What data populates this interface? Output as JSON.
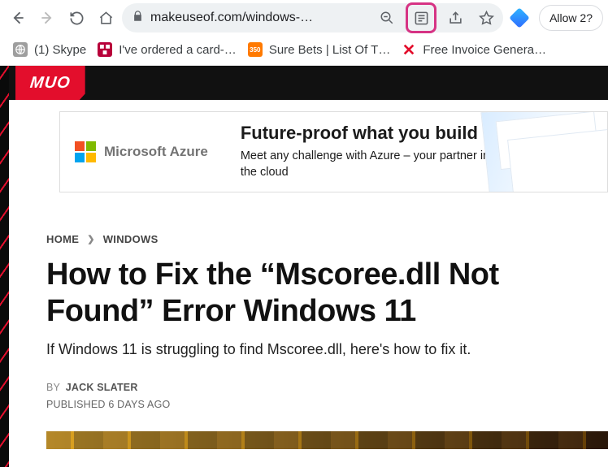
{
  "chrome": {
    "url_display": "makeuseof.com/windows-…",
    "allow_label": "Allow 2?"
  },
  "bookmarks": [
    {
      "label": "(1) Skype",
      "icon": "globe"
    },
    {
      "label": "I've ordered a card-…",
      "icon": "natwest"
    },
    {
      "label": "Sure Bets | List Of T…",
      "icon": "350"
    },
    {
      "label": "Free Invoice Genera…",
      "icon": "x"
    }
  ],
  "site": {
    "logo_text": "MUO"
  },
  "ad": {
    "brand": "Microsoft Azure",
    "headline": "Future-proof what you build",
    "sub": "Meet any challenge with Azure – your partner in the cloud"
  },
  "breadcrumbs": {
    "home": "HOME",
    "section": "WINDOWS"
  },
  "article": {
    "headline": "How to Fix the “Mscoree.dll Not Found” Error Windows 11",
    "dek": "If Windows 11 is struggling to find Mscoree.dll, here's how to fix it.",
    "byline_prefix": "BY",
    "author": "JACK SLATER",
    "published_label": "PUBLISHED 6 DAYS AGO"
  }
}
